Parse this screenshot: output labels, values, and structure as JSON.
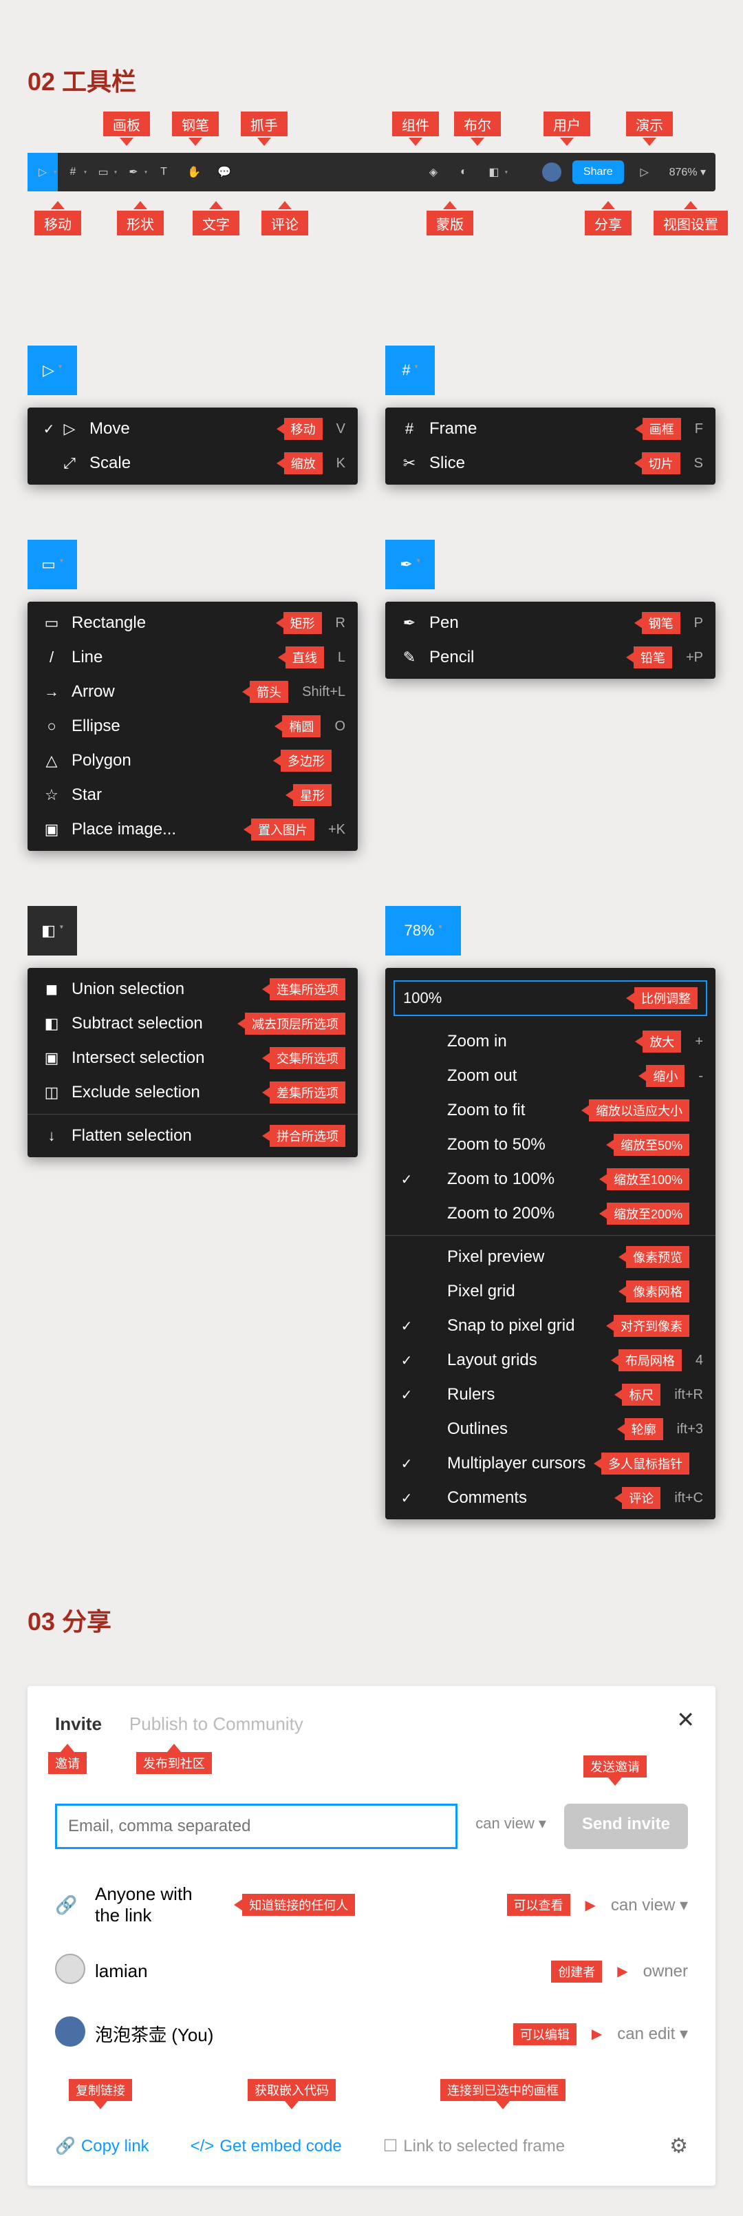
{
  "sections": {
    "toolbar_title": "02 工具栏",
    "share_title": "03 分享"
  },
  "toolbar": {
    "labels_top": [
      "画板",
      "钢笔",
      "抓手",
      "组件",
      "布尔",
      "用户",
      "演示"
    ],
    "labels_bottom": [
      "移动",
      "形状",
      "文字",
      "评论",
      "蒙版",
      "分享",
      "视图设置"
    ],
    "share_btn": "Share",
    "zoom": "876%"
  },
  "move_menu": {
    "items": [
      {
        "icon": "▷",
        "label": "Move",
        "annot": "移动",
        "shortcut": "V",
        "checked": true
      },
      {
        "icon": "⤢",
        "label": "Scale",
        "annot": "缩放",
        "shortcut": "K"
      }
    ]
  },
  "frame_menu": {
    "items": [
      {
        "icon": "#",
        "label": "Frame",
        "annot": "画框",
        "shortcut": "F"
      },
      {
        "icon": "✂",
        "label": "Slice",
        "annot": "切片",
        "shortcut": "S"
      }
    ]
  },
  "shape_menu": {
    "items": [
      {
        "icon": "▭",
        "label": "Rectangle",
        "annot": "矩形",
        "shortcut": "R"
      },
      {
        "icon": "/",
        "label": "Line",
        "annot": "直线",
        "shortcut": "L"
      },
      {
        "icon": "→",
        "label": "Arrow",
        "annot": "箭头",
        "shortcut": "Shift+L"
      },
      {
        "icon": "○",
        "label": "Ellipse",
        "annot": "椭圆",
        "shortcut": "O"
      },
      {
        "icon": "△",
        "label": "Polygon",
        "annot": "多边形",
        "shortcut": ""
      },
      {
        "icon": "☆",
        "label": "Star",
        "annot": "星形",
        "shortcut": ""
      },
      {
        "icon": "▣",
        "label": "Place image...",
        "annot": "置入图片",
        "shortcut": "+K"
      }
    ]
  },
  "pen_menu": {
    "items": [
      {
        "icon": "✒",
        "label": "Pen",
        "annot": "钢笔",
        "shortcut": "P"
      },
      {
        "icon": "✎",
        "label": "Pencil",
        "annot": "铅笔",
        "shortcut": "+P"
      }
    ]
  },
  "bool_menu": {
    "items": [
      {
        "icon": "◼",
        "label": "Union selection",
        "annot": "连集所选项"
      },
      {
        "icon": "◧",
        "label": "Subtract selection",
        "annot": "减去顶层所选项"
      },
      {
        "icon": "▣",
        "label": "Intersect selection",
        "annot": "交集所选项"
      },
      {
        "icon": "◫",
        "label": "Exclude selection",
        "annot": "差集所选项"
      },
      {
        "sep": true
      },
      {
        "icon": "↓",
        "label": "Flatten selection",
        "annot": "拼合所选项"
      }
    ]
  },
  "view_menu": {
    "button": "78%",
    "zoom_input": "100%",
    "zoom_input_annot": "比例调整",
    "group1": [
      {
        "label": "Zoom in",
        "annot": "放大",
        "shortcut": "+"
      },
      {
        "label": "Zoom out",
        "annot": "缩小",
        "shortcut": "-"
      },
      {
        "label": "Zoom to fit",
        "annot": "缩放以适应大小",
        "shortcut": ""
      },
      {
        "label": "Zoom to 50%",
        "annot": "缩放至50%",
        "shortcut": ""
      },
      {
        "label": "Zoom to 100%",
        "annot": "缩放至100%",
        "shortcut": "",
        "checked": true
      },
      {
        "label": "Zoom to 200%",
        "annot": "缩放至200%",
        "shortcut": ""
      }
    ],
    "group2": [
      {
        "label": "Pixel preview",
        "annot": "像素预览",
        "shortcut": ""
      },
      {
        "label": "Pixel grid",
        "annot": "像素网格",
        "shortcut": ""
      },
      {
        "label": "Snap to pixel grid",
        "annot": "对齐到像素",
        "shortcut": "",
        "checked": true
      },
      {
        "label": "Layout grids",
        "annot": "布局网格",
        "shortcut": "4",
        "checked": true
      },
      {
        "label": "Rulers",
        "annot": "标尺",
        "shortcut": "ift+R",
        "checked": true
      },
      {
        "label": "Outlines",
        "annot": "轮廓",
        "shortcut": "ift+3"
      },
      {
        "label": "Multiplayer cursors",
        "annot": "多人鼠标指针",
        "shortcut": "",
        "checked": true
      },
      {
        "label": "Comments",
        "annot": "评论",
        "shortcut": "ift+C",
        "checked": true
      }
    ]
  },
  "share": {
    "tabs": {
      "invite": "Invite",
      "publish": "Publish to Community"
    },
    "tabs_annot": {
      "invite": "邀请",
      "publish": "发布到社区"
    },
    "placeholder": "Email, comma separated",
    "perm": "can view",
    "send": "Send invite",
    "send_annot": "发送邀请",
    "rows": [
      {
        "icon": "link",
        "name": "Anyone with the link",
        "annot": "知道链接的任何人",
        "role_annot": "可以查看",
        "role": "can view",
        "caret": true
      },
      {
        "icon": "avimg",
        "name": "lamian",
        "role_annot": "创建者",
        "role": "owner"
      },
      {
        "icon": "av",
        "name": "泡泡茶壶 (You)",
        "role_annot": "可以编辑",
        "role": "can edit",
        "caret": true
      }
    ],
    "actions": {
      "copy": "Copy link",
      "copy_annot": "复制链接",
      "embed": "Get embed code",
      "embed_annot": "获取嵌入代码",
      "frame": "Link to selected frame",
      "frame_annot": "连接到已选中的画框"
    }
  }
}
